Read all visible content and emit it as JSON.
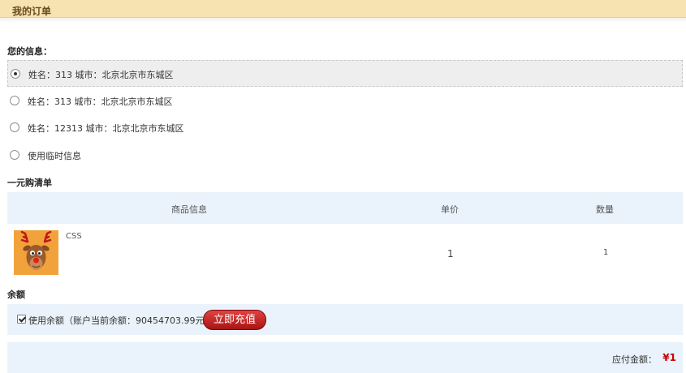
{
  "header": {
    "title": "我的订单"
  },
  "info": {
    "label": "您的信息：",
    "addresses": [
      {
        "text": "姓名：313 城市：北京北京市东城区",
        "selected": true
      },
      {
        "text": "姓名：313 城市：北京北京市东城区",
        "selected": false
      },
      {
        "text": "姓名：12313 城市：北京北京市东城区",
        "selected": false
      },
      {
        "text": "使用临时信息",
        "selected": false
      }
    ]
  },
  "cart": {
    "label": "一元购清单",
    "columns": {
      "product": "商品信息",
      "price": "单价",
      "qty": "数量"
    },
    "items": [
      {
        "name": "CSS",
        "price": "1",
        "qty": "1",
        "thumb_icon": "reindeer-icon"
      }
    ]
  },
  "balance": {
    "label": "余额",
    "use_balance_text": "使用余额（账户当前余额：90454703.99元）",
    "checked": true,
    "recharge_label": "立即充值"
  },
  "total": {
    "label": "应付金额：",
    "value": "¥1"
  },
  "colors": {
    "accent_red": "#cc0000",
    "header_bg": "#f6e3b1",
    "panel_bg": "#eaf3fb"
  }
}
